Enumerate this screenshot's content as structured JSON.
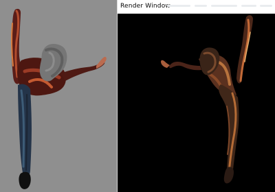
{
  "render_window": {
    "title": "Render Window"
  },
  "colors": {
    "left_background": "#8f8f8f",
    "render_background": "#000000",
    "titlebar_background": "#ffffff"
  },
  "viewports": {
    "left": {
      "subject": "dancer-figure-textured"
    },
    "right": {
      "subject": "dancer-figure-rendered"
    }
  }
}
